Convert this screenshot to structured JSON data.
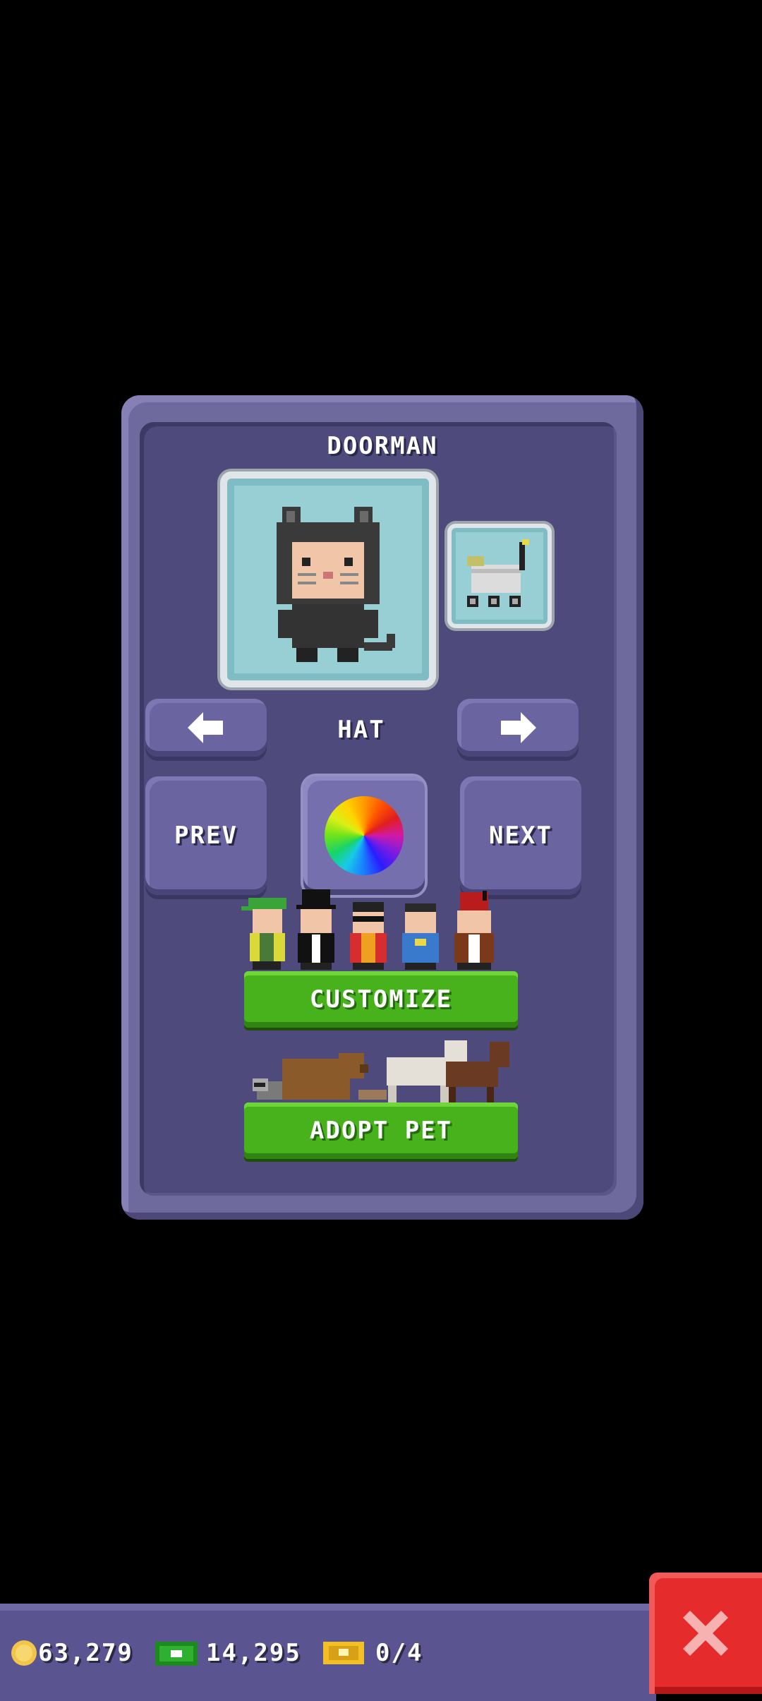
{
  "dialog": {
    "title": "DOORMAN",
    "slot_label": "HAT",
    "prev_label": "PREV",
    "next_label": "NEXT",
    "customize_label": "CUSTOMIZE",
    "adopt_label": "ADOPT PET"
  },
  "currency": {
    "coins": "63,279",
    "bux": "14,295",
    "tickets": "0/4"
  },
  "colors": {
    "panel": "#6f6a9e",
    "panel_inner": "#4f4a7c",
    "green_button": "#47b21c",
    "close_button": "#e52b2b",
    "portrait_bg": "#98cfd4"
  },
  "icons": {
    "left": "arrow-left-icon",
    "right": "arrow-right-icon",
    "color": "color-wheel-icon",
    "close": "close-icon",
    "coin": "coin-icon",
    "bux": "bux-icon",
    "ticket": "ticket-icon"
  }
}
